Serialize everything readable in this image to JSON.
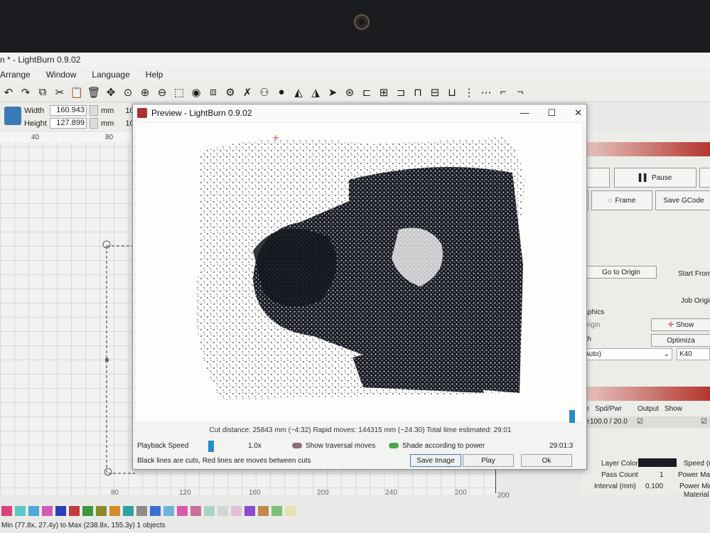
{
  "app": {
    "title": "n * - LightBurn 0.9.02",
    "menu": [
      "Arrange",
      "Window",
      "Language",
      "Help"
    ]
  },
  "toolbar_icons": [
    "undo-icon",
    "redo-icon",
    "copy-icon",
    "cut-icon",
    "paste-icon",
    "delete-icon",
    "move-icon",
    "zoom-fit-icon",
    "zoom-in-icon",
    "zoom-out-icon",
    "select-rect-icon",
    "camera-icon",
    "frame-select-icon",
    "settings-icon",
    "tools-icon",
    "users-icon",
    "user-icon",
    "mirror-h-icon",
    "mirror-v-icon",
    "send-icon",
    "target-icon",
    "align-left-icon",
    "align-center-icon",
    "align-right-icon",
    "align-top-icon",
    "align-middle-icon",
    "align-bottom-icon",
    "distribute-h-icon",
    "distribute-v-icon",
    "group-icon",
    "ungroup-icon"
  ],
  "dimensions": {
    "width_label": "Width",
    "width_value": "160.943",
    "width_unit": "mm",
    "width_extra": "100.",
    "height_label": "Height",
    "height_value": "127.899",
    "height_unit": "mm",
    "height_extra": "100."
  },
  "ruler": {
    "top": [
      "40",
      "80"
    ],
    "bottom": [
      "40",
      "80",
      "120",
      "160",
      "200",
      "240",
      "200"
    ],
    "bottom_right": "200"
  },
  "right_panel": {
    "pause": "Pause",
    "frame": "Frame",
    "save_gcode": "Save GCode",
    "go_to_origin": "Go to Origin",
    "start_from": "Start From:",
    "job_origin": "Job Origin",
    "graphics": "raphics",
    "origin": "Origin",
    "show": "Show",
    "path": "ath",
    "optimization": "Optimiza",
    "auto_select": "Auto)",
    "device": "K40",
    "layer_cols": [
      "de",
      "Spd/Pwr",
      "Output",
      "Show"
    ],
    "layer_row": {
      "mode": "ge",
      "spd_pwr": "100.0 / 20.0"
    }
  },
  "layer_params": {
    "layer_color": "Layer Color",
    "speed": "Speed (m",
    "pass_count": "Pass Count",
    "pass_value": "1",
    "power_max": "Power Max",
    "interval": "Interval (mm)",
    "interval_value": "0.100",
    "power_min": "Power Min",
    "material": "Material ("
  },
  "palette": [
    "#d8447a",
    "#5cc7c5",
    "#4fa8d8",
    "#d05ab3",
    "#2a3fb8",
    "#c33b3b",
    "#3b9a3b",
    "#8a8a2a",
    "#d4892a",
    "#2fa3a3",
    "#8c8c8c",
    "#3b6fd4",
    "#6fb4d8",
    "#d75aa8",
    "#c86f9a",
    "#a9d4c4",
    "#d4d4d4",
    "#e2c1d6",
    "#8a4bd1",
    "#c48a4b",
    "#7bbf7b",
    "#e6e2b0"
  ],
  "status": {
    "text": "Min (77.8x, 27.4y) to Max (238.8x, 155.3y)  1 objects"
  },
  "preview": {
    "title": "Preview - LightBurn 0.9.02",
    "stats": "Cut distance: 25843 mm (~4:32)   Rapid moves: 144315 mm (~24:30)   Total time estimated: 29:01",
    "playback_label": "Playback Speed",
    "playback_value": "1.0x",
    "show_traversal": "Show traversal moves",
    "shade_power": "Shade according to power",
    "time": "29:01:3",
    "legend": "Black lines are cuts, Red lines are moves between cuts",
    "save_image": "Save Image",
    "play": "Play",
    "ok": "Ok"
  }
}
